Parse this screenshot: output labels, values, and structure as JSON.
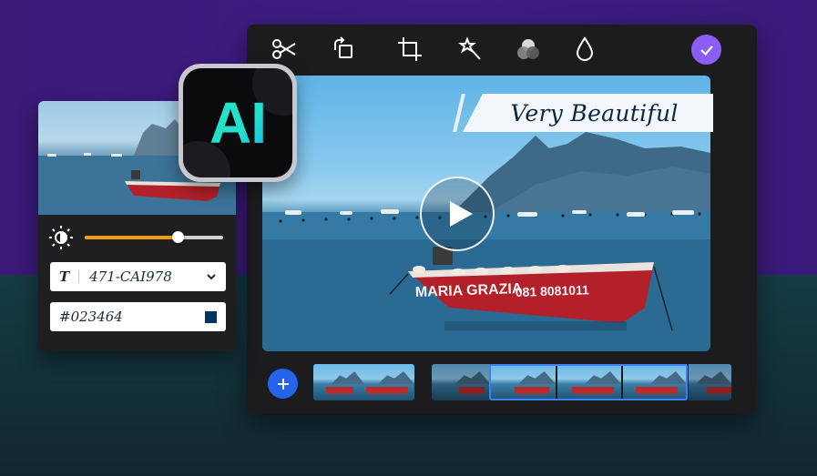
{
  "ai_badge": {
    "label": "AI"
  },
  "toolbar": {
    "tools": [
      {
        "name": "scissors-icon"
      },
      {
        "name": "rotate-icon"
      },
      {
        "name": "crop-icon"
      },
      {
        "name": "magic-wand-icon"
      },
      {
        "name": "color-filter-icon"
      },
      {
        "name": "water-drop-icon"
      }
    ],
    "confirm_icon": "check-icon",
    "confirm_color": "#8b5cf6"
  },
  "preview": {
    "title_text": "Very Beautiful",
    "boat_text_left": "MARIA GRAZIA",
    "boat_text_right": "081 8081011"
  },
  "adjust_panel": {
    "brightness_icon": "brightness-icon",
    "brightness_level": 0.67,
    "font_field": {
      "icon": "T",
      "value": "471-CAI978"
    },
    "color_field": {
      "value": "#023464",
      "swatch": "#023464"
    }
  },
  "timeline": {
    "add_icon": "plus-icon",
    "accent": "#3b82f6"
  }
}
